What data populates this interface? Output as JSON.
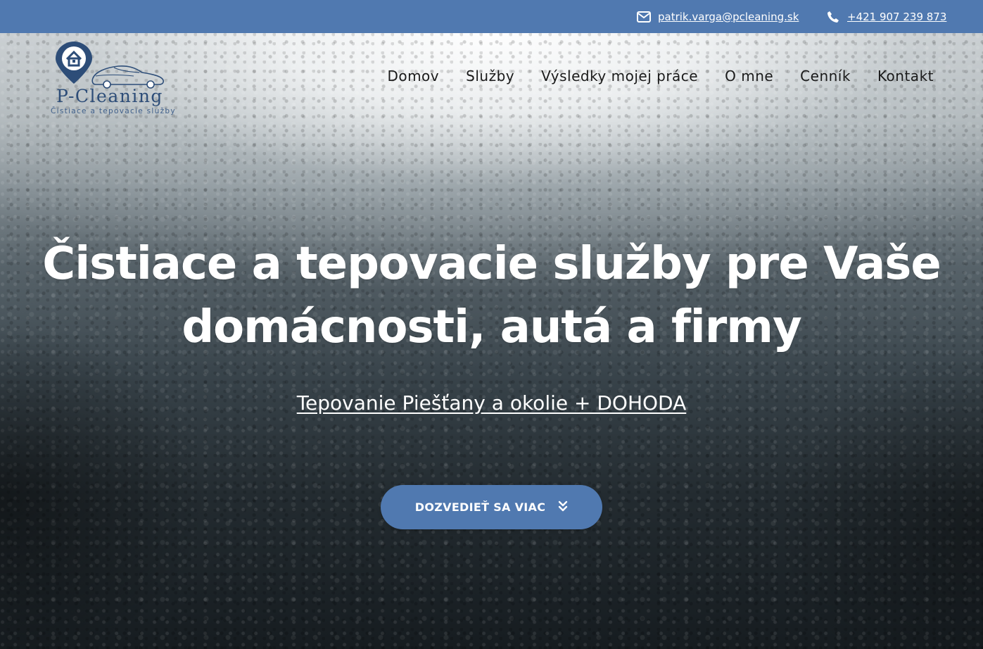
{
  "topbar": {
    "email": "patrik.varga@pcleaning.sk",
    "phone": "+421 907 239 873",
    "email_icon": "envelope-icon",
    "phone_icon": "phone-icon",
    "background": "#5079b0"
  },
  "logo": {
    "name": "P-Cleaning",
    "tagline": "Čistiace a tepovacie služby"
  },
  "nav": {
    "items": [
      {
        "label": "Domov"
      },
      {
        "label": "Služby"
      },
      {
        "label": "Výsledky mojej práce"
      },
      {
        "label": "O mne"
      },
      {
        "label": "Cenník"
      },
      {
        "label": "Kontakt"
      }
    ]
  },
  "hero": {
    "headline_line1": "Čistiace a tepovacie služby pre Vaše",
    "headline_line2": "domácnosti, autá a firmy",
    "subheadline": "Tepovanie Piešťany a okolie + DOHODA",
    "cta_label": "DOZVEDIEŤ SA VIAC",
    "cta_icon": "double-chevron-down-icon",
    "accent": "#5079b0"
  }
}
